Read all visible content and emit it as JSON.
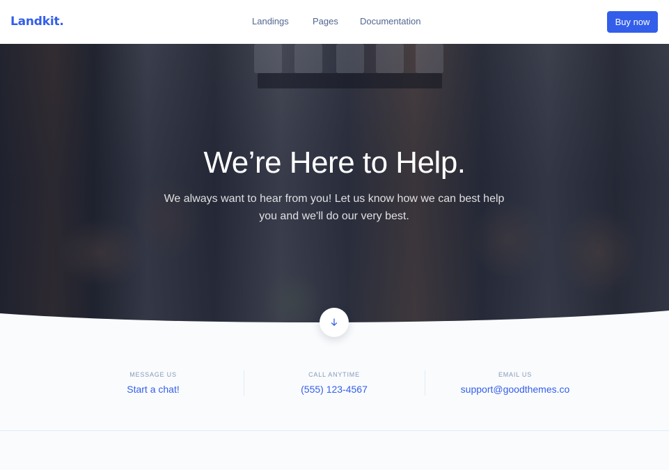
{
  "navbar": {
    "brand": "Landkit.",
    "links": [
      "Landings",
      "Pages",
      "Documentation"
    ],
    "cta_label": "Buy now"
  },
  "hero": {
    "title": "We’re Here to Help.",
    "lead": "We always want to hear from you! Let us know how we can best help you and we'll do our very best.",
    "scroll_icon": "arrow-down-icon"
  },
  "contact": {
    "items": [
      {
        "label": "Message us",
        "value": "Start a chat!"
      },
      {
        "label": "Call anytime",
        "value": "(555) 123-4567"
      },
      {
        "label": "Email us",
        "value": "support@goodthemes.co"
      }
    ]
  },
  "colors": {
    "primary": "#335eea",
    "muted": "#869ab8",
    "nav_text": "#506690",
    "background": "#f9fbfd"
  }
}
